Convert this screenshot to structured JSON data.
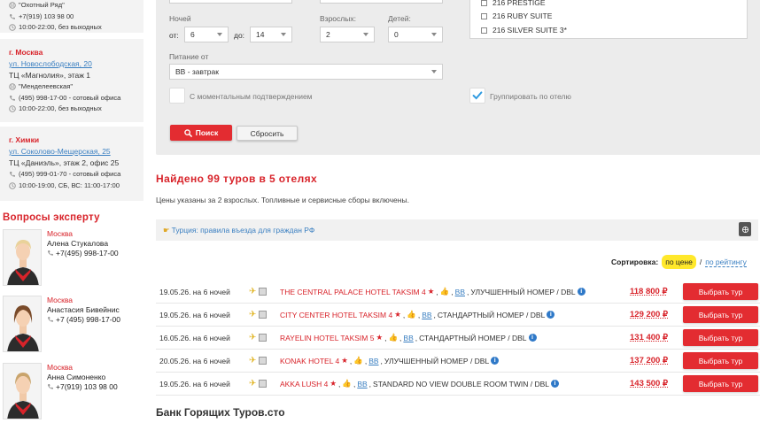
{
  "offices": [
    {
      "tc_metro": "\"Охотный Ряд\"",
      "phone": "+7(919) 103 98 00",
      "hours": "10:00-22:00, без выходных"
    },
    {
      "city": "г. Москва",
      "street": "ул. Новослободская, 20",
      "tc": "ТЦ «Магнолия», этаж 1",
      "metro": "\"Менделеевская\"",
      "phone": "(495) 998-17-00 - сотовый офиса",
      "hours": "10:00-22:00, без выходных"
    },
    {
      "city": "г. Химки",
      "street": "ул. Соколово-Мещерская, 25",
      "tc": "ТЦ «Даниэль», этаж 2, офис 25",
      "phone": "(495) 999-01-70 - сотовый офиса",
      "hours": "10:00-19:00, СБ, ВС: 11:00-17:00"
    }
  ],
  "experts": {
    "title": "Вопросы эксперту",
    "items": [
      {
        "city": "Москва",
        "name": "Алена Стукалова",
        "phone": "+7(495) 998-17-00"
      },
      {
        "city": "Москва",
        "name": "Анастасия Бивейнис",
        "phone": "+7 (495) 998-17-00"
      },
      {
        "city": "Москва",
        "name": "Анна Симоненко",
        "phone": "+7(919) 103 98 00"
      }
    ]
  },
  "filter": {
    "nights_label": "Ночей",
    "from_label": "от:",
    "from_value": "6",
    "to_label": "до:",
    "to_value": "14",
    "adults_label": "Взрослых:",
    "adults_value": "2",
    "children_label": "Детей:",
    "children_value": "0",
    "meal_label": "Питание от",
    "meal_value": "BB - завтрак",
    "instant_label": "С моментальным подтверждением",
    "group_label": "Группировать по отелю",
    "search_label": "Поиск",
    "reset_label": "Сбросить",
    "hotels": [
      "216 PRESTIGE",
      "216 RUBY SUITE",
      "216 SILVER SUITE 3*"
    ]
  },
  "results": {
    "found": "Найдено 99 туров в 5 отелях",
    "note": "Цены указаны за 2 взрослых. Топливные и сервисные сборы включены.",
    "notice": "Турция: правила въезда для граждан РФ",
    "sort_label": "Сортировка:",
    "sort_price": "по цене",
    "sort_sep": "/",
    "sort_rating": "по рейтингу",
    "choose_label": "Выбрать тур",
    "tours": [
      {
        "date": "19.05.26. на 6 ночей",
        "hotel": "THE CENTRAL PALACE HOTEL TAKSIM 4",
        "meal": "BB",
        "room": "УЛУЧШЕННЫЙ НОМЕР / DBL",
        "price": "118 800 ₽"
      },
      {
        "date": "19.05.26. на 6 ночей",
        "hotel": "CITY CENTER HOTEL TAKSIM 4",
        "meal": "BB",
        "room": "СТАНДАРТНЫЙ НОМЕР / DBL",
        "price": "129 200 ₽"
      },
      {
        "date": "16.05.26. на 6 ночей",
        "hotel": "RAYELIN HOTEL TAKSIM 5",
        "meal": "BB",
        "room": "СТАНДАРТНЫЙ НОМЕР / DBL",
        "price": "131 400 ₽"
      },
      {
        "date": "20.05.26. на 6 ночей",
        "hotel": "KONAK HOTEL 4",
        "meal": "BB",
        "room": "УЛУЧШЕННЫЙ НОМЕР / DBL",
        "price": "137 200 ₽"
      },
      {
        "date": "19.05.26. на 6 ночей",
        "hotel": "AKKA LUSH 4",
        "meal": "BB",
        "room": "STANDARD NO VIEW DOUBLE ROOM TWIN / DBL",
        "price": "143 500 ₽"
      }
    ],
    "next_heading": "Банк Горящих Туров.сто"
  }
}
